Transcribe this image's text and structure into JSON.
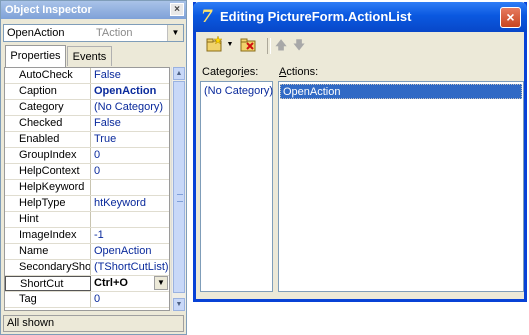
{
  "object_inspector": {
    "title": "Object Inspector",
    "close_glyph": "×",
    "selected_component": {
      "name": "OpenAction",
      "type": "TAction"
    },
    "tabs": [
      {
        "label": "Properties",
        "active": true
      },
      {
        "label": "Events",
        "active": false
      }
    ],
    "properties": [
      {
        "name": "AutoCheck",
        "value": "False"
      },
      {
        "name": "Caption",
        "value": "OpenAction",
        "bold": true
      },
      {
        "name": "Category",
        "value": "(No Category)"
      },
      {
        "name": "Checked",
        "value": "False"
      },
      {
        "name": "Enabled",
        "value": "True"
      },
      {
        "name": "GroupIndex",
        "value": "0"
      },
      {
        "name": "HelpContext",
        "value": "0"
      },
      {
        "name": "HelpKeyword",
        "value": ""
      },
      {
        "name": "HelpType",
        "value": "htKeyword"
      },
      {
        "name": "Hint",
        "value": ""
      },
      {
        "name": "ImageIndex",
        "value": "-1"
      },
      {
        "name": "Name",
        "value": "OpenAction"
      },
      {
        "name": "SecondaryShortCuts",
        "value": "(TShortCutList)"
      },
      {
        "name": "ShortCut",
        "value": "Ctrl+O",
        "selected": true
      },
      {
        "name": "Tag",
        "value": "0"
      }
    ],
    "status": "All shown"
  },
  "action_list_editor": {
    "title": "Editing PictureForm.ActionList",
    "logo_glyph": "7",
    "close_glyph": "×",
    "toolbar": {
      "new_action_icon": "new-action-icon",
      "delete_icon": "delete-action-icon",
      "move_up_icon": "arrow-up-icon",
      "move_down_icon": "arrow-down-icon"
    },
    "categories_label": {
      "before": "Categor",
      "accel": "i",
      "after": "es:"
    },
    "actions_label": {
      "before": "",
      "accel": "A",
      "after": "ctions:"
    },
    "categories": [
      "(No Category)"
    ],
    "actions": [
      "OpenAction"
    ]
  },
  "colors": {
    "editor_title_bar": "#0a58e0",
    "selection": "#316ac5",
    "value_text": "#0a2a9c"
  }
}
